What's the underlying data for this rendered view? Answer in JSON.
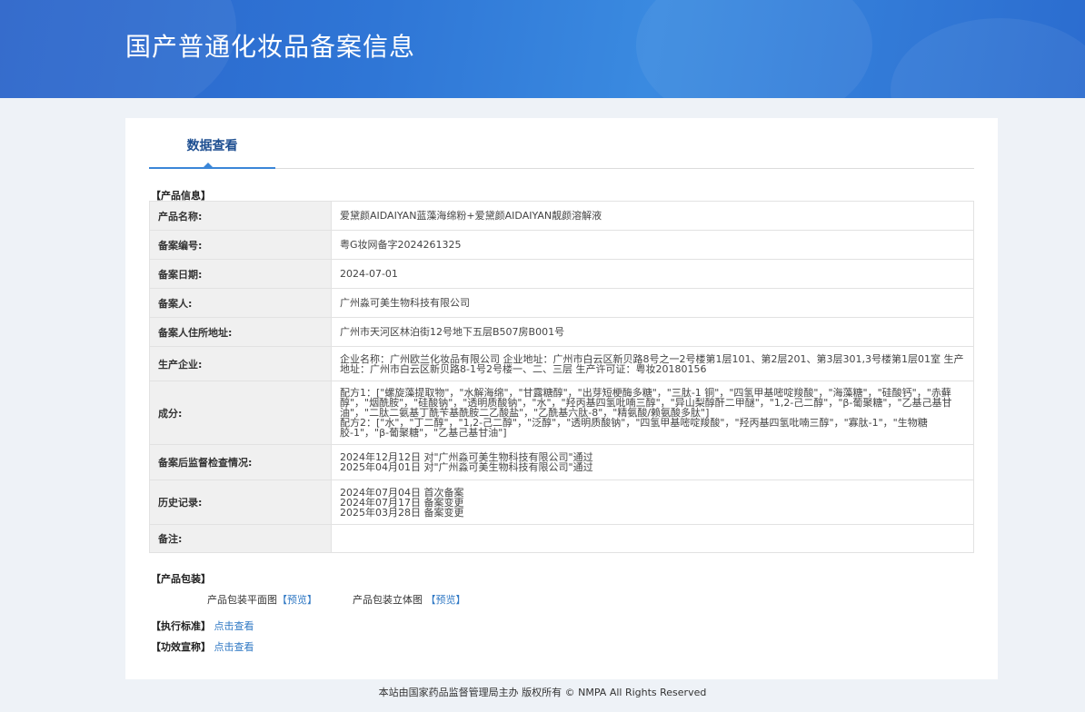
{
  "header": {
    "title": "国产普通化妆品备案信息"
  },
  "tabs": [
    {
      "label": "数据查看"
    }
  ],
  "product_info": {
    "section_title": "【产品信息】",
    "rows": [
      {
        "label": "产品名称:",
        "lines": [
          "爱黛颜AIDAIYAN蓝藻海绵粉+爱黛颜AIDAIYAN靓颜溶解液"
        ]
      },
      {
        "label": "备案编号:",
        "lines": [
          "粤G妆网备字2024261325"
        ]
      },
      {
        "label": "备案日期:",
        "lines": [
          "2024-07-01"
        ]
      },
      {
        "label": "备案人:",
        "lines": [
          "广州淼可美生物科技有限公司"
        ]
      },
      {
        "label": "备案人住所地址:",
        "lines": [
          "广州市天河区林泊街12号地下五层B507房B001号"
        ]
      },
      {
        "label": "生产企业:",
        "lines": [
          "企业名称：广州欧兰化妆品有限公司 企业地址：广州市白云区新贝路8号之一2号楼第1层101、第2层201、第3层301,3号楼第1层01室 生产",
          "地址：广州市白云区新贝路8-1号2号楼一、二、三层 生产许可证：粤妆20180156"
        ]
      },
      {
        "label": "成分:",
        "lines": [
          "配方1：[\"螺旋藻提取物\"，\"水解海绵\"，\"甘露糖醇\"，\"出芽短梗酶多糖\"，\"三肽-1 铜\"，\"四氢甲基嘧啶羧酸\"，\"海藻糖\"，\"硅酸钙\"，\"赤藓",
          "醇\"，\"烟酰胺\"，\"硅酸钠\"，\"透明质酸钠\"，\"水\"，\"羟丙基四氢吡喃三醇\"，\"异山梨醇酐二甲醚\"，\"1,2-己二醇\"，\"β-葡聚糖\"，\"乙基己基甘",
          "油\"，\"二肽二氨基丁酰苄基酰胺二乙酸盐\"，\"乙酰基六肽-8\"，\"精氨酸/赖氨酸多肽\"]",
          "配方2：[\"水\"，\"丁二醇\"，\"1,2-己二醇\"，\"泛醇\"，\"透明质酸钠\"，\"四氢甲基嘧啶羧酸\"，\"羟丙基四氢吡喃三醇\"，\"寡肽-1\"，\"生物糖",
          "胶-1\"，\"β-葡聚糖\"，\"乙基己基甘油\"]"
        ]
      },
      {
        "label": "备案后监督检查情况:",
        "lines": [
          "2024年12月12日 对\"广州淼可美生物科技有限公司\"通过",
          "2025年04月01日 对\"广州淼可美生物科技有限公司\"通过"
        ]
      },
      {
        "label": "历史记录:",
        "lines": [
          "2024年07月04日 首次备案",
          "2024年07月17日 备案变更",
          "2025年03月28日 备案变更"
        ]
      },
      {
        "label": "备注:",
        "lines": []
      }
    ]
  },
  "packaging": {
    "section_title": "【产品包装】",
    "flat_label": "产品包装平面图",
    "flat_link": "【预览】",
    "solid_label": "产品包装立体图",
    "solid_link": "【预览】"
  },
  "standard": {
    "label": "【执行标准】",
    "link": "点击查看"
  },
  "efficacy": {
    "label": "【功效宣称】",
    "link": "点击查看"
  },
  "footer": {
    "text": "本站由国家药品监督管理局主办 版权所有 © NMPA All Rights Reserved"
  },
  "colors": {
    "banner": "#2f76d6",
    "accent": "#3a86d8",
    "link": "#2f78c4"
  }
}
